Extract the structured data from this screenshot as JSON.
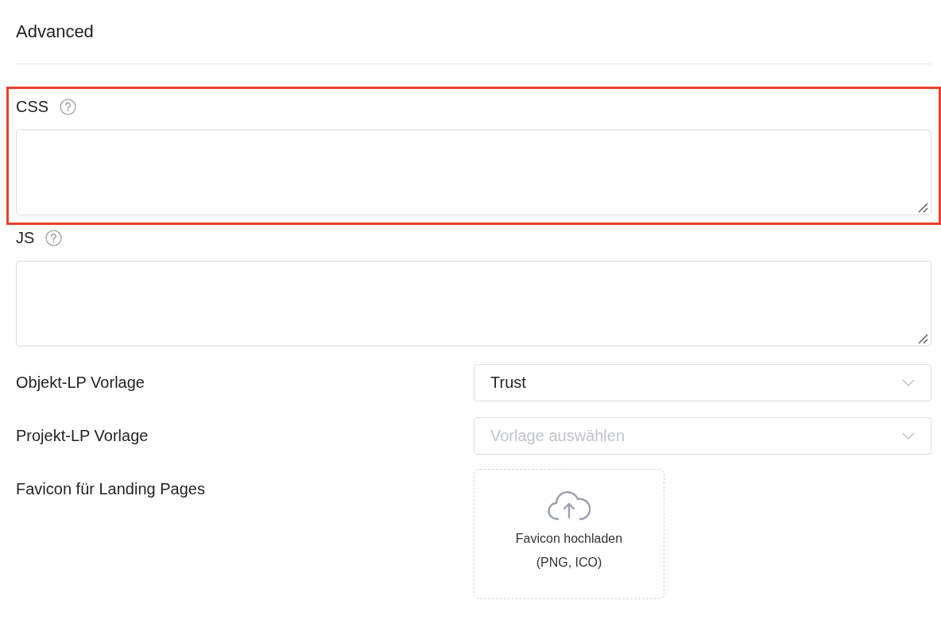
{
  "section": {
    "title": "Advanced"
  },
  "fields": [
    {
      "kind": "textarea",
      "label": "CSS",
      "help": true,
      "highlighted": true
    },
    {
      "kind": "textarea",
      "label": "JS",
      "help": true,
      "highlighted": false
    },
    {
      "kind": "select",
      "label": "Objekt-LP Vorlage",
      "value": "Trust"
    },
    {
      "kind": "select",
      "label": "Projekt-LP Vorlage",
      "placeholder": "Vorlage auswählen"
    },
    {
      "kind": "upload",
      "label": "Favicon für Landing Pages",
      "upload_text": "Favicon hochladen",
      "upload_hint": "(PNG, ICO)"
    }
  ]
}
